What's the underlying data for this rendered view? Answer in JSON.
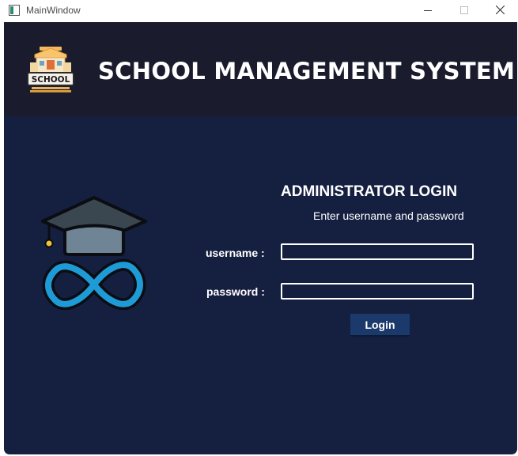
{
  "window": {
    "title": "MainWindow",
    "icon": "app-window-icon",
    "controls": [
      "minimize-icon",
      "maximize-icon",
      "close-icon"
    ]
  },
  "header": {
    "title": "SCHOOL MANAGEMENT SYSTEM",
    "logo_text": "SCHOOL",
    "logo_icon": "school-building-icon"
  },
  "login": {
    "title": "ADMINISTRATOR LOGIN",
    "subtitle": "Enter username and password",
    "username_label": "username :",
    "username_value": "",
    "password_label": "password :",
    "password_value": "",
    "button_label": "Login",
    "side_icon": "graduation-cap-infinity-icon"
  },
  "colors": {
    "header_bg": "#1a1c2e",
    "body_bg": "#152041",
    "button_bg": "#1b3a6b",
    "infinity_blue": "#1e9bd7"
  }
}
